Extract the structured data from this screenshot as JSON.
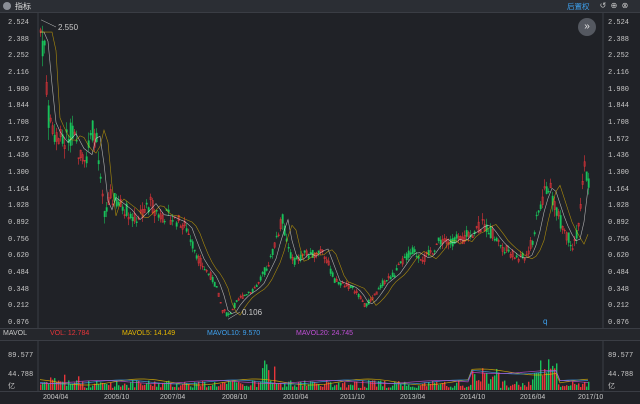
{
  "window": {
    "title": "指标",
    "restore_label": "后置权",
    "icons": [
      "undo-icon",
      "add-icon",
      "close-icon"
    ],
    "expand_icon": "»"
  },
  "price_axis": {
    "ticks": [
      "2.524",
      "2.388",
      "2.252",
      "2.116",
      "1.980",
      "1.844",
      "1.708",
      "1.572",
      "1.436",
      "1.300",
      "1.164",
      "1.028",
      "0.892",
      "0.756",
      "0.620",
      "0.484",
      "0.348",
      "0.212",
      "0.076"
    ]
  },
  "annotations": {
    "high": "2.550",
    "low": "0.106",
    "marker": "q"
  },
  "volume_panel": {
    "name": "MAVOL",
    "vol": "VOL: 12.784",
    "ma5": "MAVOL5: 14.149",
    "ma10": "MAVOL10: 9.570",
    "ma20": "MAVOL20: 24.745",
    "ticks": [
      "89.577",
      "44.788"
    ],
    "unit": "亿"
  },
  "dates": [
    "2004/04",
    "2005/10",
    "2007/04",
    "2008/10",
    "2010/04",
    "2011/10",
    "2013/04",
    "2014/10",
    "2016/04",
    "2017/10"
  ],
  "colors": {
    "up": "#e8353a",
    "down": "#19c25a",
    "ma5": "#f0f0f0",
    "ma10": "#e6b800",
    "ma20": "#c04fd6",
    "mavol5": "#e6b800",
    "mavol10": "#3ea2f0",
    "mavol20": "#c04fd6"
  }
}
